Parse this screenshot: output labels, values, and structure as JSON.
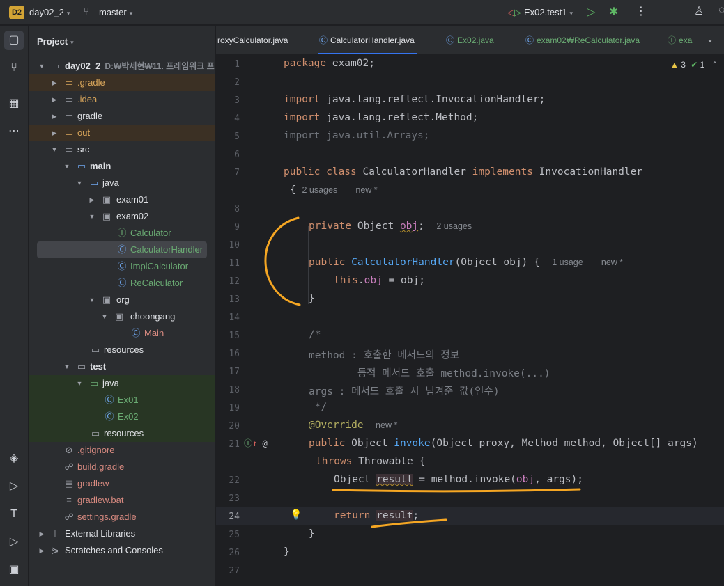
{
  "topbar": {
    "project_badge": "D2",
    "project_name": "day02_2",
    "branch": "master",
    "run_config": "Ex02.test1"
  },
  "toolstrip": {
    "top_icons": [
      "folder-icon",
      "commit-icon",
      "structure-icon",
      "more-icon"
    ],
    "bottom_icons": [
      "layers-icon",
      "services-icon",
      "terminal-t-icon",
      "run-icon",
      "console-icon"
    ]
  },
  "project_panel": {
    "title": "Project",
    "tree": [
      {
        "label": "day02_2",
        "path": "D:₩박세현₩11. 프레임워크 프",
        "icon": "folder-icon",
        "kind": "root"
      },
      {
        "label": ".gradle",
        "icon": "folder-icon",
        "kind": "excluded"
      },
      {
        "label": ".idea",
        "icon": "folder-icon",
        "kind": "normal"
      },
      {
        "label": "gradle",
        "icon": "folder-icon",
        "kind": "normal"
      },
      {
        "label": "out",
        "icon": "folder-icon",
        "kind": "excluded"
      },
      {
        "label": "src",
        "icon": "folder-icon",
        "kind": "normal"
      },
      {
        "label": "main",
        "icon": "folder-icon",
        "kind": "normal"
      },
      {
        "label": "java",
        "icon": "folder-icon",
        "kind": "normal"
      },
      {
        "label": "exam01",
        "icon": "package-icon",
        "kind": "normal"
      },
      {
        "label": "exam02",
        "icon": "package-icon",
        "kind": "normal"
      },
      {
        "label": "Calculator",
        "icon": "interface-icon",
        "kind": "normal"
      },
      {
        "label": "CalculatorHandler",
        "icon": "class-icon",
        "kind": "selected"
      },
      {
        "label": "ImplCalculator",
        "icon": "class-icon",
        "kind": "normal"
      },
      {
        "label": "ReCalculator",
        "icon": "class-icon",
        "kind": "normal"
      },
      {
        "label": "org",
        "icon": "package-icon",
        "kind": "normal"
      },
      {
        "label": "choongang",
        "icon": "package-icon",
        "kind": "normal"
      },
      {
        "label": "Main",
        "icon": "main-class-icon",
        "kind": "normal"
      },
      {
        "label": "resources",
        "icon": "folder-icon",
        "kind": "normal"
      },
      {
        "label": "test",
        "icon": "folder-icon",
        "kind": "normal"
      },
      {
        "label": "java",
        "icon": "folder-icon",
        "kind": "test"
      },
      {
        "label": "Ex01",
        "icon": "test-class-icon",
        "kind": "test"
      },
      {
        "label": "Ex02",
        "icon": "test-class-icon",
        "kind": "test"
      },
      {
        "label": "resources",
        "icon": "folder-icon",
        "kind": "test"
      },
      {
        "label": ".gitignore",
        "icon": "ignore-icon",
        "kind": "normal"
      },
      {
        "label": "build.gradle",
        "icon": "gradle-icon",
        "kind": "normal"
      },
      {
        "label": "gradlew",
        "icon": "shell-icon",
        "kind": "normal"
      },
      {
        "label": "gradlew.bat",
        "icon": "text-file-icon",
        "kind": "normal"
      },
      {
        "label": "settings.gradle",
        "icon": "gradle-icon",
        "kind": "normal"
      },
      {
        "label": "External Libraries",
        "icon": "library-icon",
        "kind": "normal"
      },
      {
        "label": "Scratches and Consoles",
        "icon": "scratch-icon",
        "kind": "normal"
      }
    ]
  },
  "tabs": [
    {
      "label": "roxyCalculator.java",
      "active": false
    },
    {
      "label": "CalculatorHandler.java",
      "active": true
    },
    {
      "label": "Ex02.java",
      "active": false
    },
    {
      "label": "exam02₩ReCalculator.java",
      "active": false
    },
    {
      "label": "exa",
      "active": false
    }
  ],
  "editor": {
    "inspections": {
      "warnings": "3",
      "checks": "1"
    },
    "line_numbers": [
      "1",
      "2",
      "3",
      "4",
      "5",
      "6",
      "7",
      "8",
      "9",
      "10",
      "11",
      "12",
      "13",
      "14",
      "15",
      "16",
      "17",
      "18",
      "19",
      "20",
      "21",
      "22",
      "23",
      "24",
      "25",
      "26",
      "27"
    ],
    "current_line": "24",
    "hints": {
      "class_usages": "2 usages",
      "class_new": "new *",
      "field_usages": "2 usages",
      "ctor_usages": "1 usage",
      "ctor_new": "new *",
      "override_new": "new *"
    },
    "comments": {
      "open": "/*",
      "c1": "method : 호출한 메서드의 정보",
      "c2": "        동적 메서드 호출 method.invoke(...)",
      "c3": "args : 메서드 호출 시 넘겨준 값(인수)",
      "close": " */"
    }
  }
}
